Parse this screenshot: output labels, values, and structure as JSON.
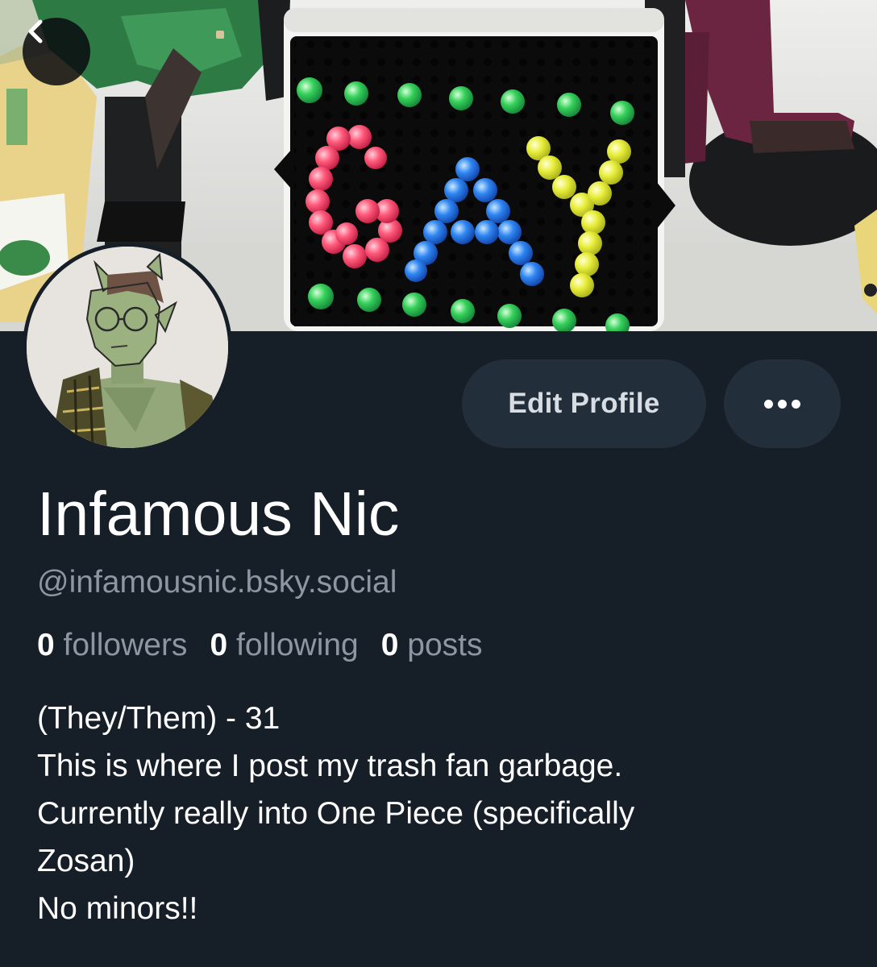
{
  "profile": {
    "display_name": "Infamous Nic",
    "handle": "@infamousnic.bsky.social",
    "stats": {
      "followers_count": "0",
      "followers_label": "followers",
      "following_count": "0",
      "following_label": "following",
      "posts_count": "0",
      "posts_label": "posts"
    },
    "bio_lines": [
      "(They/Them) - 31",
      "This is where I post my trash fan garbage.",
      "Currently really into One Piece (specifically",
      "Zosan)",
      "No minors!!"
    ]
  },
  "actions": {
    "edit_profile_label": "Edit Profile",
    "more_icon": "ellipsis-icon",
    "back_icon": "chevron-left-icon"
  },
  "banner": {
    "pegboard_text": "GAY"
  },
  "colors": {
    "background": "#161e27",
    "button_bg": "#232e3b",
    "muted_text": "#8d97a4",
    "primary_text": "#ffffff"
  }
}
